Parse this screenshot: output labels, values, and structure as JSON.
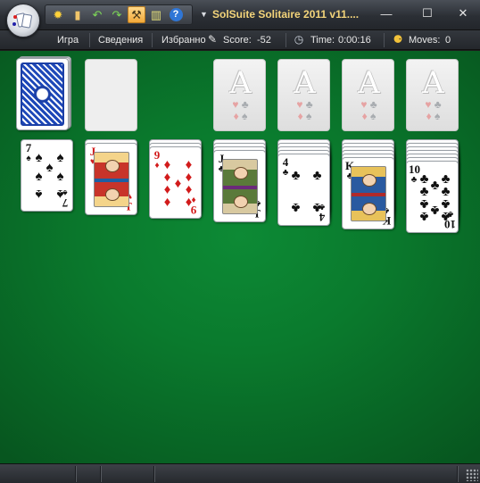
{
  "window": {
    "title": "SolSuite Solitaire 2011 v11....",
    "controls": {
      "minimize": "—",
      "maximize": "☐",
      "close": "✕"
    }
  },
  "quick_access": [
    {
      "name": "new-game-icon",
      "glyph": "✹",
      "color": "#ffd23a"
    },
    {
      "name": "card-icon",
      "glyph": "▮",
      "color": "#f0c56a"
    },
    {
      "name": "undo-icon",
      "glyph": "↶",
      "color": "#7ed957"
    },
    {
      "name": "redo-icon",
      "glyph": "↷",
      "color": "#7ed957"
    },
    {
      "name": "hint-icon",
      "glyph": "⚒",
      "color": "#4a3a1a",
      "active": true
    },
    {
      "name": "statistics-icon",
      "glyph": "▥",
      "color": "#e7e27a"
    },
    {
      "name": "help-icon",
      "glyph": "?",
      "color": "#ffffff"
    }
  ],
  "menu": {
    "items": [
      "Игра",
      "Сведения",
      "Избранно"
    ]
  },
  "stats": {
    "score_label": "Score:",
    "score_value": "-52",
    "time_label": "Time:",
    "time_value": "0:00:16",
    "moves_label": "Moves:",
    "moves_value": "0"
  },
  "colors": {
    "felt": "#0a7a2d",
    "title_text": "#f3d47a",
    "red_suit": "#d21b1b"
  },
  "foundations": [
    {
      "rank": "A",
      "suits": [
        "♥",
        "♣",
        "♦",
        "♠"
      ]
    },
    {
      "rank": "A",
      "suits": [
        "♥",
        "♣",
        "♦",
        "♠"
      ]
    },
    {
      "rank": "A",
      "suits": [
        "♥",
        "♣",
        "♦",
        "♠"
      ]
    },
    {
      "rank": "A",
      "suits": [
        "♥",
        "♣",
        "♦",
        "♠"
      ]
    }
  ],
  "tableau": [
    {
      "hidden": 0,
      "top": {
        "rank": "7",
        "suit": "♠",
        "color": "black"
      }
    },
    {
      "hidden": 1,
      "top": {
        "rank": "J",
        "suit": "♥",
        "color": "red",
        "face": "jack-hearts"
      }
    },
    {
      "hidden": 2,
      "top": {
        "rank": "9",
        "suit": "♦",
        "color": "red"
      }
    },
    {
      "hidden": 3,
      "top": {
        "rank": "J",
        "suit": "♣",
        "color": "black",
        "face": "jack-clubs"
      }
    },
    {
      "hidden": 4,
      "top": {
        "rank": "4",
        "suit": "♣",
        "color": "black"
      }
    },
    {
      "hidden": 5,
      "top": {
        "rank": "K",
        "suit": "♣",
        "color": "black",
        "face": "king-clubs"
      }
    },
    {
      "hidden": 6,
      "top": {
        "rank": "10",
        "suit": "♣",
        "color": "black"
      }
    }
  ]
}
